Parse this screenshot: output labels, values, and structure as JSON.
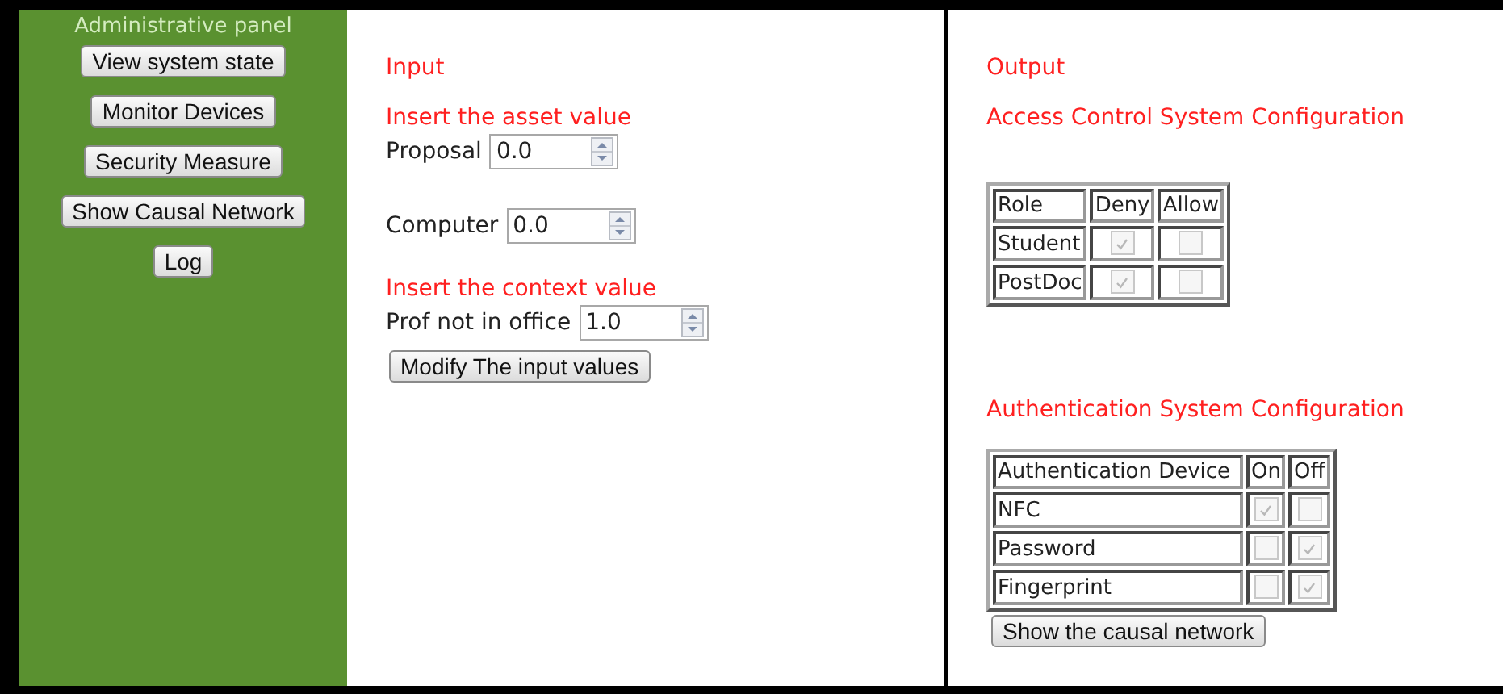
{
  "sidebar": {
    "title": "Administrative panel",
    "buttons": [
      "View system state",
      "Monitor Devices",
      "Security Measure",
      "Show Causal Network",
      "Log"
    ]
  },
  "input": {
    "heading": "Input",
    "asset_heading": "Insert the asset value",
    "asset_fields": [
      {
        "label": "Proposal",
        "value": "0.0"
      },
      {
        "label": "Computer",
        "value": "0.0"
      }
    ],
    "context_heading": "Insert the context value",
    "context_fields": [
      {
        "label": "Prof not in office",
        "value": "1.0"
      }
    ],
    "button": "Modify The input values"
  },
  "output": {
    "heading": "Output",
    "access_control": {
      "title": "Access Control System Configuration",
      "columns": [
        "Role",
        "Deny",
        "Allow"
      ],
      "rows": [
        {
          "name": "Student",
          "cells": [
            {
              "checked": true,
              "disabled": true
            },
            {
              "checked": false,
              "disabled": true
            }
          ]
        },
        {
          "name": "PostDoc",
          "cells": [
            {
              "checked": true,
              "disabled": true
            },
            {
              "checked": false,
              "disabled": true
            }
          ]
        }
      ]
    },
    "authentication": {
      "title": "Authentication System Configuration",
      "columns": [
        "Authentication Device",
        "On",
        "Off"
      ],
      "rows": [
        {
          "name": "NFC",
          "cells": [
            {
              "checked": true,
              "disabled": true
            },
            {
              "checked": false,
              "disabled": true
            }
          ]
        },
        {
          "name": "Password",
          "cells": [
            {
              "checked": false,
              "disabled": true
            },
            {
              "checked": true,
              "disabled": true
            }
          ]
        },
        {
          "name": "Fingerprint",
          "cells": [
            {
              "checked": false,
              "disabled": true
            },
            {
              "checked": true,
              "disabled": true
            }
          ]
        }
      ]
    },
    "button": "Show the causal network"
  }
}
